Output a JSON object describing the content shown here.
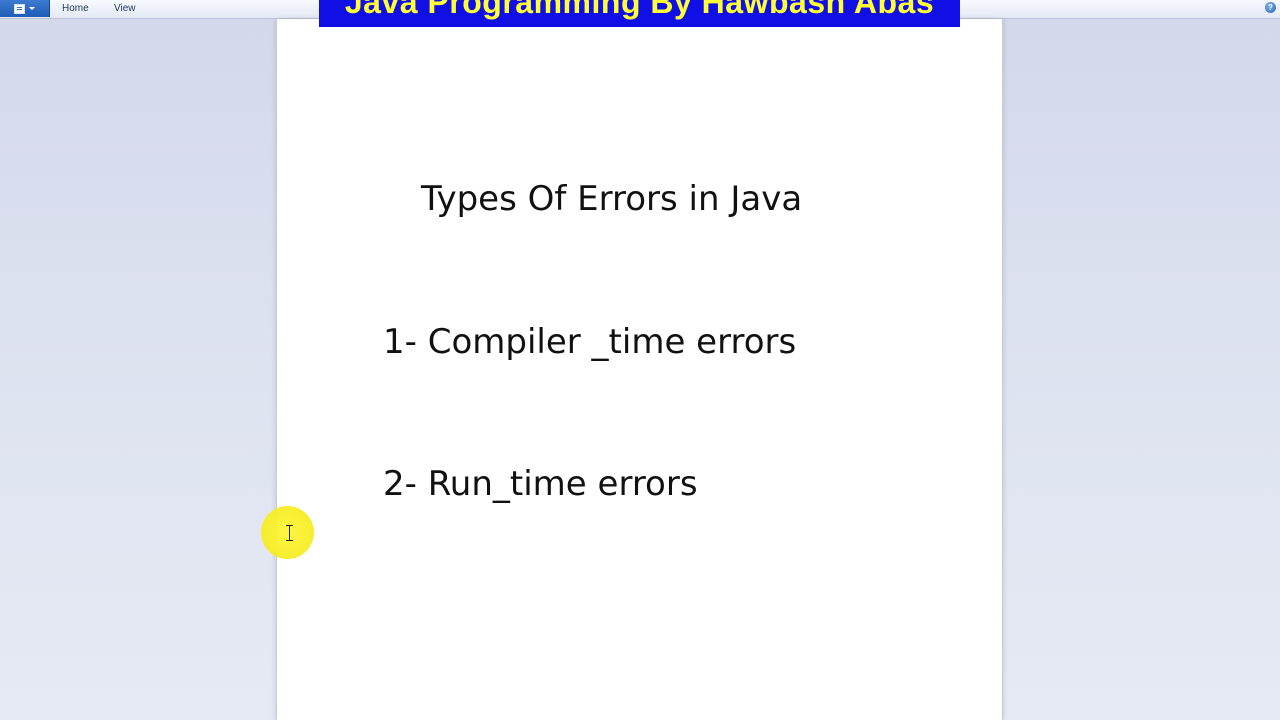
{
  "ribbon": {
    "tabs": [
      {
        "label": "Home"
      },
      {
        "label": "View"
      }
    ],
    "app_menu_icon": "document-icon",
    "help_icon": "help-icon",
    "help_glyph": "?"
  },
  "banner": {
    "text": "Java Programming By Hawbash Abas",
    "background": "#1010e6",
    "color": "#ffff33"
  },
  "document": {
    "heading": "Types Of Errors in Java",
    "items": [
      "1- Compiler _time errors",
      "2- Run_time errors"
    ]
  },
  "cursor": {
    "icon": "ibeam-cursor-icon",
    "highlight_color": "#f7ee26"
  }
}
